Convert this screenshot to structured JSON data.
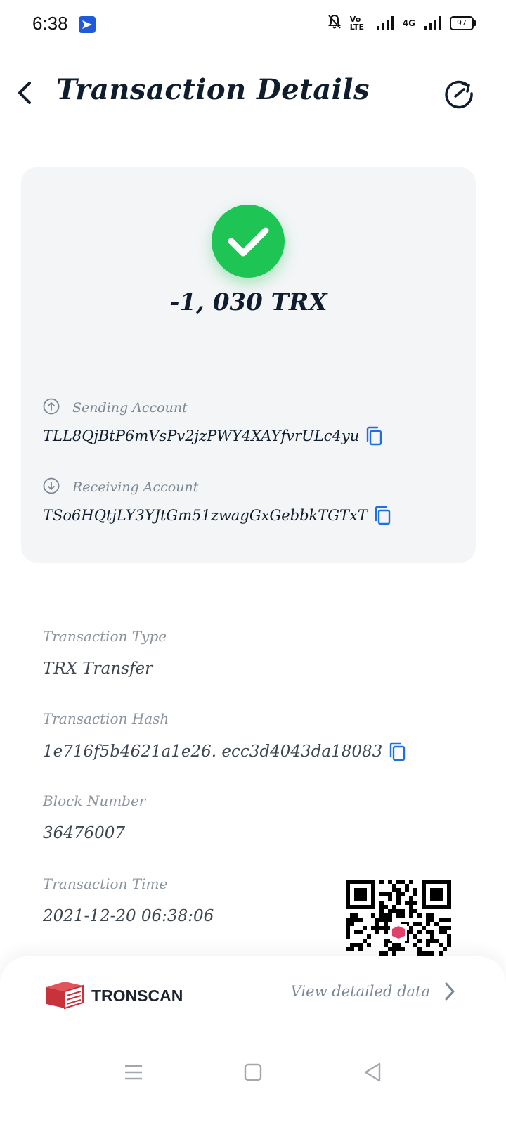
{
  "status_bar": {
    "time": "6:38",
    "network": "4G",
    "volte": "Vo LTE",
    "battery": "97"
  },
  "header": {
    "title": "Transaction Details"
  },
  "summary": {
    "amount": "-1, 030 TRX",
    "status_color": "#1ec454"
  },
  "accounts": {
    "sending": {
      "label": "Sending Account",
      "address": "TLL8QjBtP6mVsPv2jzPWY4XAYfvrULc4yu"
    },
    "receiving": {
      "label": "Receiving Account",
      "address": "TSo6HQtjLY3YJtGm51zwagGxGebbkTGTxT"
    }
  },
  "details": {
    "type": {
      "label": "Transaction Type",
      "value": "TRX Transfer"
    },
    "hash": {
      "label": "Transaction Hash",
      "value": "1e716f5b4621a1e26. ecc3d4043da18083"
    },
    "block": {
      "label": "Block Number",
      "value": "36476007"
    },
    "time": {
      "label": "Transaction Time",
      "value": "2021-12-20 06:38:06"
    }
  },
  "footer": {
    "brand": "TRONSCAN",
    "view_detail": "View detailed data"
  },
  "colors": {
    "accent_blue": "#1f6fe0",
    "brand_red": "#c8323a",
    "card_bg": "#f3f5f7"
  }
}
